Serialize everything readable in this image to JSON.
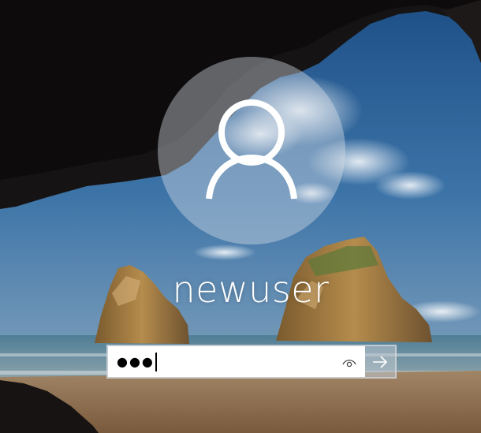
{
  "user": {
    "name": "newuser"
  },
  "password": {
    "masked_value": "●●●"
  },
  "icons": {
    "avatar": "user-silhouette-icon",
    "reveal": "eye-icon",
    "submit": "arrow-right-icon"
  },
  "colors": {
    "sky": "#2d5f8f",
    "text": "#ffffff",
    "field_bg": "#ffffff",
    "avatar_circle": "rgba(215,222,230,0.42)"
  }
}
